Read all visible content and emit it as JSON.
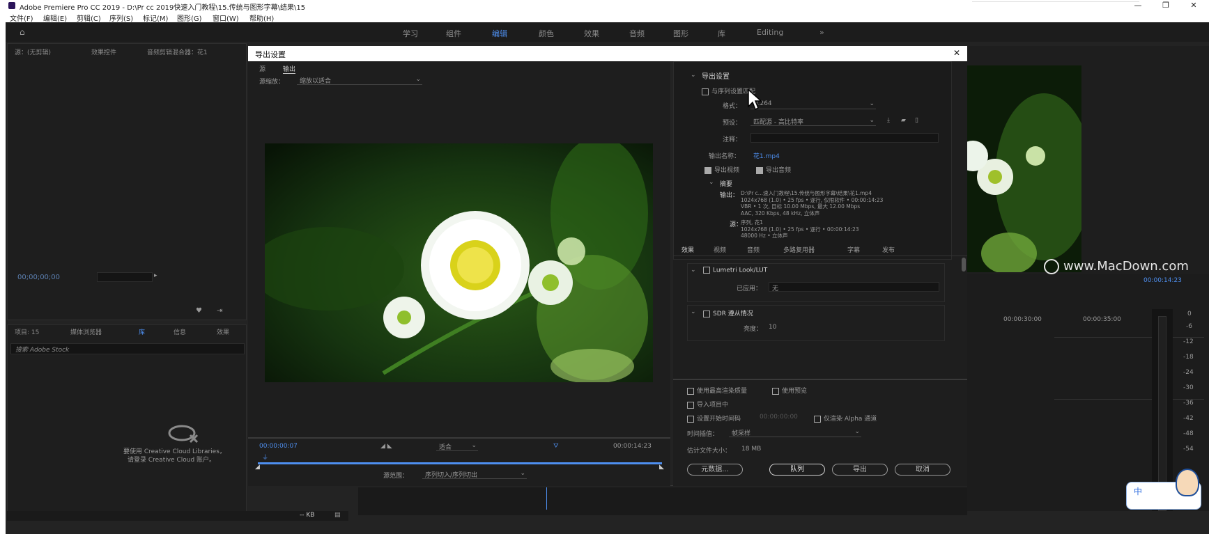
{
  "window": {
    "title": "Adobe Premiere Pro CC 2019 - D:\\Pr cc 2019快速入门教程\\15.传统与图形字幕\\结果\\15"
  },
  "menu": [
    "文件(F)",
    "编辑(E)",
    "剪辑(C)",
    "序列(S)",
    "标记(M)",
    "图形(G)",
    "窗口(W)",
    "帮助(H)"
  ],
  "workspace_tabs": [
    "学习",
    "组件",
    "编辑",
    "颜色",
    "效果",
    "音频",
    "图形",
    "库",
    "Editing",
    "»"
  ],
  "left_panel": {
    "tabs": [
      "源：(无剪辑)",
      "效果控件",
      "音频剪辑混合器：花1"
    ],
    "timecode": "00;00;00;00",
    "project_tabs": [
      "项目: 15",
      "媒体浏览器",
      "库",
      "信息",
      "效果"
    ],
    "search_placeholder": "搜索 Adobe Stock",
    "cc_msg1": "要使用 Creative Cloud Libraries，",
    "cc_msg2": "请登录 Creative Cloud 账户。",
    "bottom_status": "-- KB"
  },
  "dialog": {
    "title": "导出设置",
    "close": "✕",
    "source_tab": "源",
    "output_tab": "输出",
    "scaling_label": "源缩放：",
    "scaling_value": "缩放以适合",
    "timecode_start": "00:00:00:07",
    "fit_value": "适合",
    "timecode_end": "00:00:14:23",
    "range_label": "源范围：",
    "range_value": "序列切入/序列切出",
    "export_settings_title": "导出设置",
    "match_sequence": "与序列设置匹配",
    "format_label": "格式：",
    "format_value": "H.264",
    "preset_label": "预设：",
    "preset_value": "匹配源 - 高比特率",
    "comment_label": "注释：",
    "output_name_label": "输出名称：",
    "output_name_value": "花1.mp4",
    "export_video": "导出视频",
    "export_audio": "导出音频",
    "summary_title": "摘要",
    "summary_output_label": "输出：",
    "summary_output_lines": [
      "D:\\Pr c...速入门教程\\15.传统与图形字幕\\结果\\花1.mp4",
      "1024x768 (1.0) • 25 fps • 逐行, 仅限软件 • 00:00:14:23",
      "VBR • 1 次, 目标 10.00 Mbps, 最大 12.00 Mbps",
      "AAC, 320 Kbps, 48 kHz, 立体声"
    ],
    "summary_source_label": "源：",
    "summary_source_lines": [
      "序列, 花1",
      "1024x768 (1.0) • 25 fps • 逐行 • 00:00:14:23",
      "48000 Hz • 立体声"
    ],
    "settings_tabs": [
      "效果",
      "视频",
      "音频",
      "多路复用器",
      "字幕",
      "发布"
    ],
    "lumetri_title": "Lumetri Look/LUT",
    "applied_label": "已应用：",
    "applied_value": "无",
    "sdr_title": "SDR 遵从情况",
    "brightness_label": "亮度：",
    "brightness_value": "10",
    "use_max_render": "使用最高渲染质量",
    "use_preview": "使用预览",
    "import_project": "导入项目中",
    "set_timecode": "设置开始时间码",
    "set_timecode_value": "00:00:00:00",
    "render_alpha": "仅渲染 Alpha 通道",
    "interp_label": "时间插值：",
    "interp_value": "帧采样",
    "filesize_label": "估计文件大小：",
    "filesize_value": "18 MB",
    "btn_metadata": "元数据...",
    "btn_queue": "队列",
    "btn_export": "导出",
    "btn_cancel": "取消"
  },
  "timeline": {
    "timecode": "00:00:14:23",
    "ruler": [
      "00:00:30:00",
      "00:00:35:00"
    ],
    "meter_labels": [
      "0",
      "-6",
      "-12",
      "-18",
      "-24",
      "-30",
      "-36",
      "-42",
      "-48",
      "-54"
    ]
  },
  "watermark": "www.MacDown.com",
  "ime": {
    "label": "中"
  }
}
